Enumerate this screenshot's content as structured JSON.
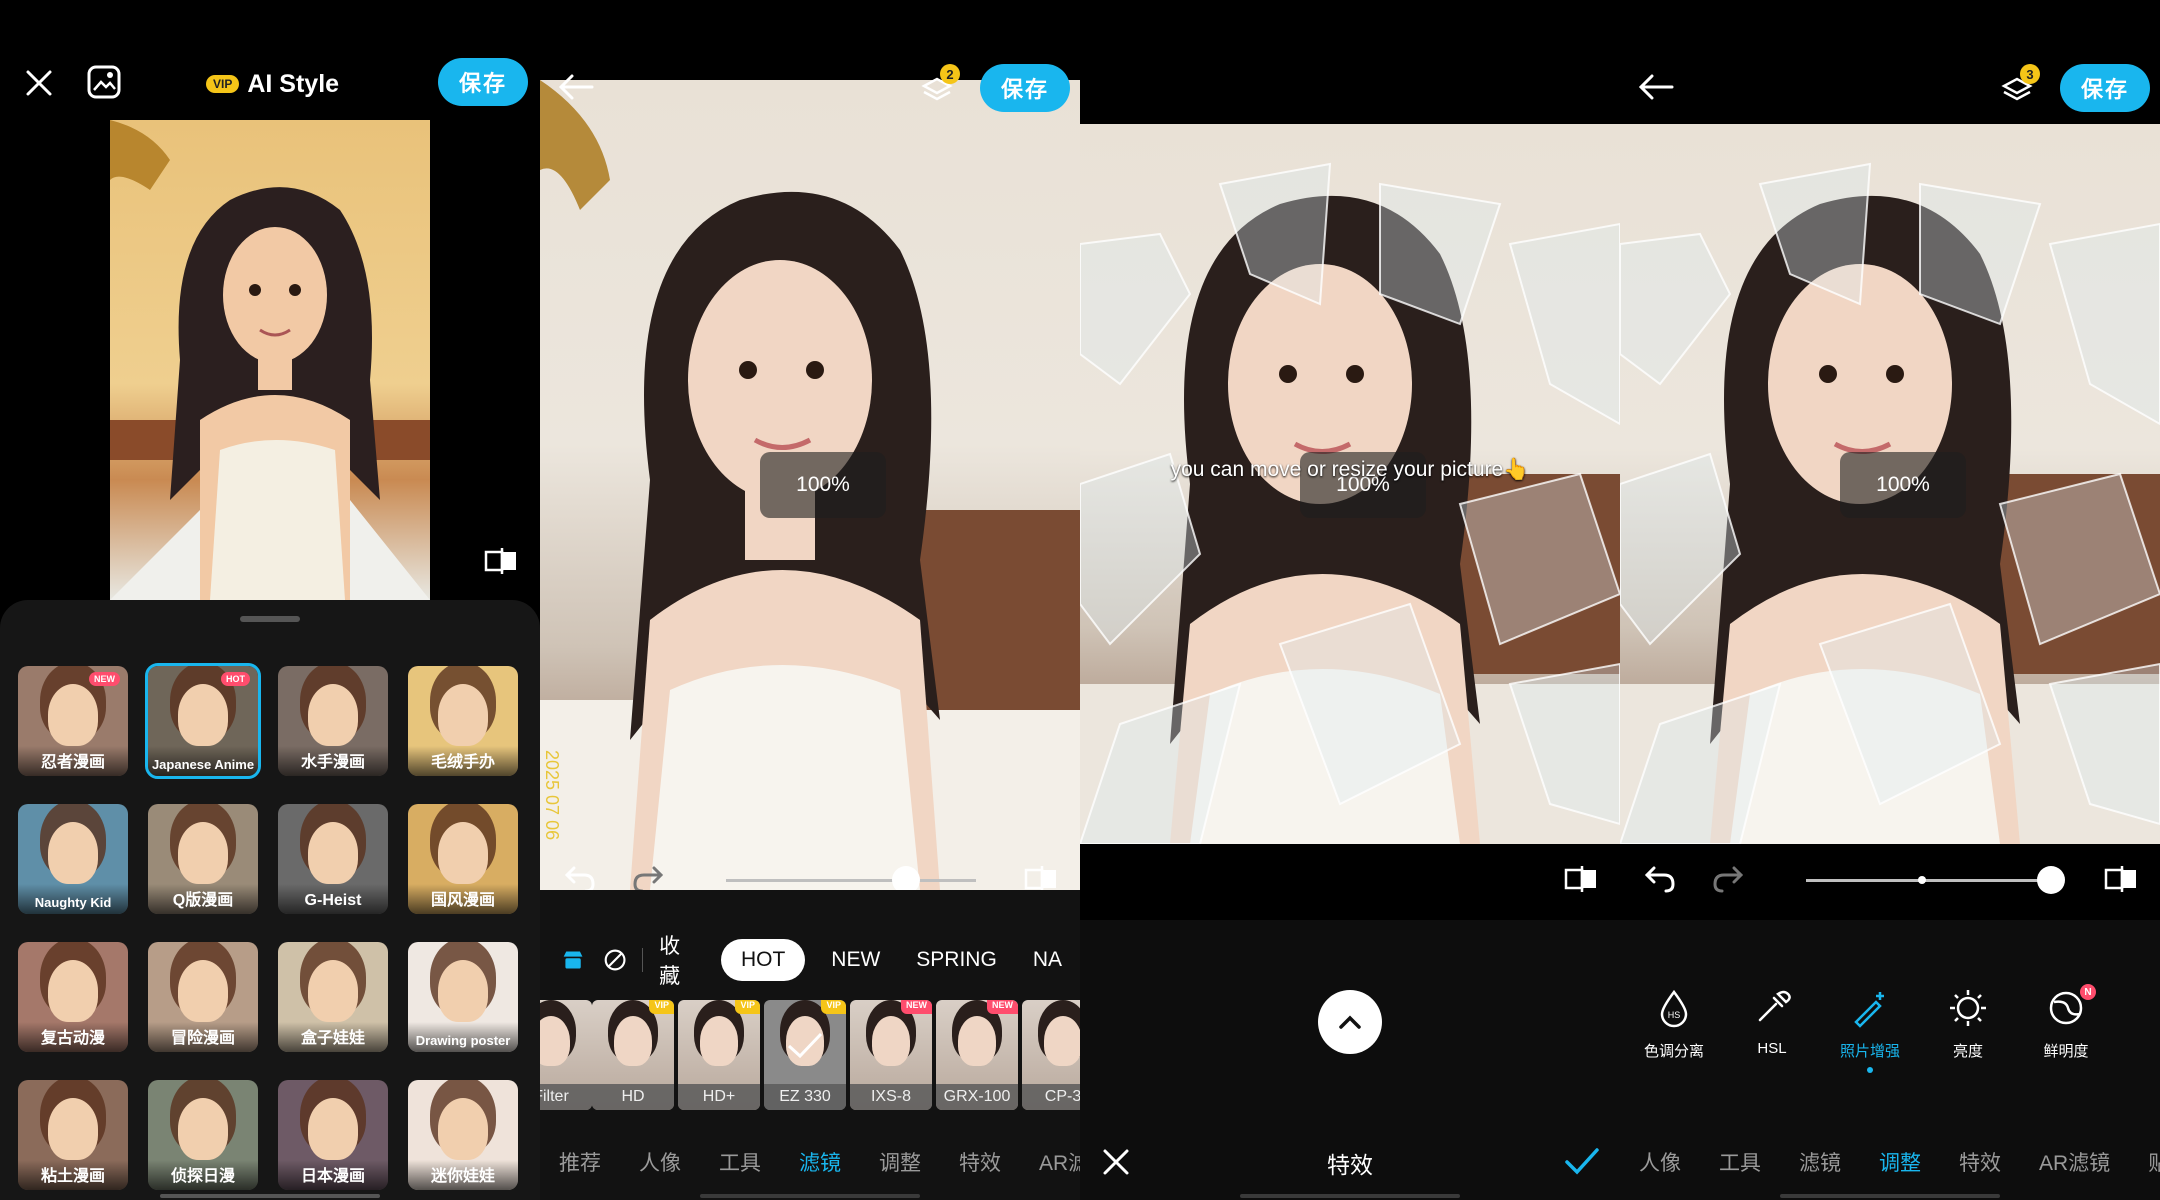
{
  "screen1": {
    "title": "AI Style",
    "vip_badge": "VIP",
    "save_label": "保存",
    "styles": [
      {
        "label": "忍者漫画",
        "tag": "NEW",
        "tag_color": "#ff4d6d",
        "selected": false,
        "bg": "#9a7b6b"
      },
      {
        "label": "Japanese Anime",
        "tag": "HOT",
        "tag_color": "#ff4d6d",
        "selected": true,
        "bg": "#6f6659"
      },
      {
        "label": "水手漫画",
        "tag": "",
        "tag_color": "",
        "selected": false,
        "bg": "#7a6c64"
      },
      {
        "label": "毛绒手办",
        "tag": "",
        "tag_color": "",
        "selected": false,
        "bg": "#e7c57c"
      },
      {
        "label": "Naughty Kid",
        "tag": "",
        "tag_color": "",
        "selected": false,
        "bg": "#5f8fa8"
      },
      {
        "label": "Q版漫画",
        "tag": "",
        "tag_color": "",
        "selected": false,
        "bg": "#9a8b78"
      },
      {
        "label": "G-Heist",
        "tag": "",
        "tag_color": "",
        "selected": false,
        "bg": "#6a6a6a"
      },
      {
        "label": "国风漫画",
        "tag": "",
        "tag_color": "",
        "selected": false,
        "bg": "#d8ad62"
      },
      {
        "label": "复古动漫",
        "tag": "",
        "tag_color": "",
        "selected": false,
        "bg": "#a5786a"
      },
      {
        "label": "冒险漫画",
        "tag": "",
        "tag_color": "",
        "selected": false,
        "bg": "#b79d88"
      },
      {
        "label": "盒子娃娃",
        "tag": "",
        "tag_color": "",
        "selected": false,
        "bg": "#cfc1a8"
      },
      {
        "label": "Drawing poster",
        "tag": "",
        "tag_color": "",
        "selected": false,
        "bg": "#efe8e2"
      },
      {
        "label": "粘土漫画",
        "tag": "",
        "tag_color": "",
        "selected": false,
        "bg": "#8b6b5a"
      },
      {
        "label": "侦探日漫",
        "tag": "",
        "tag_color": "",
        "selected": false,
        "bg": "#7a8473"
      },
      {
        "label": "日本漫画",
        "tag": "",
        "tag_color": "",
        "selected": false,
        "bg": "#6e5a66"
      },
      {
        "label": "迷你娃娃",
        "tag": "",
        "tag_color": "",
        "selected": false,
        "bg": "#efe3da"
      }
    ]
  },
  "screen2": {
    "save_label": "保存",
    "layers_count": "2",
    "zoom": "100%",
    "watermark_date": "2025 07 06",
    "slider_level": 0.72,
    "filter_tabs": [
      "收藏",
      "HOT",
      "NEW",
      "SPRING",
      "NA"
    ],
    "active_filter_tab": "HOT",
    "filters": [
      {
        "label": "Filter",
        "vip": false,
        "new": false
      },
      {
        "label": "HD",
        "vip": true,
        "new": false
      },
      {
        "label": "HD+",
        "vip": true,
        "new": false
      },
      {
        "label": "EZ 330",
        "vip": true,
        "new": false,
        "selected": true
      },
      {
        "label": "IXS-8",
        "vip": false,
        "new": true
      },
      {
        "label": "GRX-100",
        "vip": false,
        "new": true
      },
      {
        "label": "CP-3",
        "vip": false,
        "new": false
      }
    ],
    "vip_tag": "VIP",
    "new_tag": "NEW",
    "bottom_nav": [
      "推荐",
      "人像",
      "工具",
      "滤镜",
      "调整",
      "特效",
      "AR滤"
    ],
    "active_nav": "滤镜"
  },
  "screen3": {
    "zoom": "100%",
    "hint_text": "you can move or resize your picture👆",
    "title": "特效"
  },
  "screen4": {
    "save_label": "保存",
    "layers_count": "3",
    "zoom": "100%",
    "slider_level": 0.98,
    "tools": [
      {
        "label": "色调分离",
        "icon": "drop-hs-icon",
        "on": false
      },
      {
        "label": "HSL",
        "icon": "dropper-icon",
        "on": false
      },
      {
        "label": "照片增强",
        "icon": "wand-icon",
        "on": true
      },
      {
        "label": "亮度",
        "icon": "sun-icon",
        "on": false
      },
      {
        "label": "鲜明度",
        "icon": "vibrance-icon",
        "on": false,
        "badge": "N"
      }
    ],
    "bottom_nav": [
      "人像",
      "工具",
      "滤镜",
      "调整",
      "特效",
      "AR滤镜",
      "贴"
    ],
    "active_nav": "调整"
  },
  "colors": {
    "accent": "#19b6ee",
    "vip": "#f5c518"
  }
}
